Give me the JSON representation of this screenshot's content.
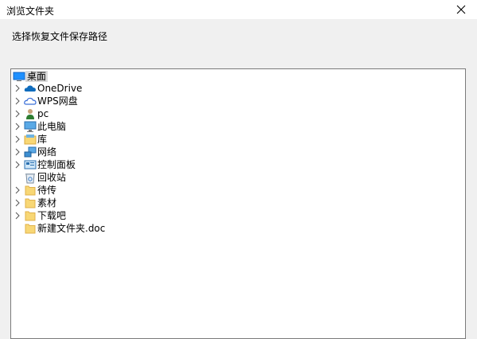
{
  "window": {
    "title": "浏览文件夹",
    "instruction": "选择恢复文件保存路径"
  },
  "tree": {
    "items": [
      {
        "label": "桌面",
        "icon": "desktop-icon",
        "expandable": false,
        "selected": true
      },
      {
        "label": "OneDrive",
        "icon": "onedrive-cloud-icon",
        "expandable": true
      },
      {
        "label": "WPS网盘",
        "icon": "wps-cloud-icon",
        "expandable": true
      },
      {
        "label": "pc",
        "icon": "user-icon",
        "expandable": true
      },
      {
        "label": "此电脑",
        "icon": "computer-icon",
        "expandable": true
      },
      {
        "label": "库",
        "icon": "library-icon",
        "expandable": true
      },
      {
        "label": "网络",
        "icon": "network-icon",
        "expandable": true
      },
      {
        "label": "控制面板",
        "icon": "control-panel-icon",
        "expandable": true
      },
      {
        "label": "回收站",
        "icon": "recycle-bin-icon",
        "expandable": false
      },
      {
        "label": "待传",
        "icon": "folder-icon",
        "expandable": true
      },
      {
        "label": "素材",
        "icon": "folder-icon",
        "expandable": true
      },
      {
        "label": "下载吧",
        "icon": "folder-icon",
        "expandable": true
      },
      {
        "label": "新建文件夹.doc",
        "icon": "folder-icon",
        "expandable": false
      }
    ]
  },
  "colors": {
    "selection": "#d9d9d9",
    "folder": "#f8d775",
    "onedrive": "#0f6cbd"
  }
}
